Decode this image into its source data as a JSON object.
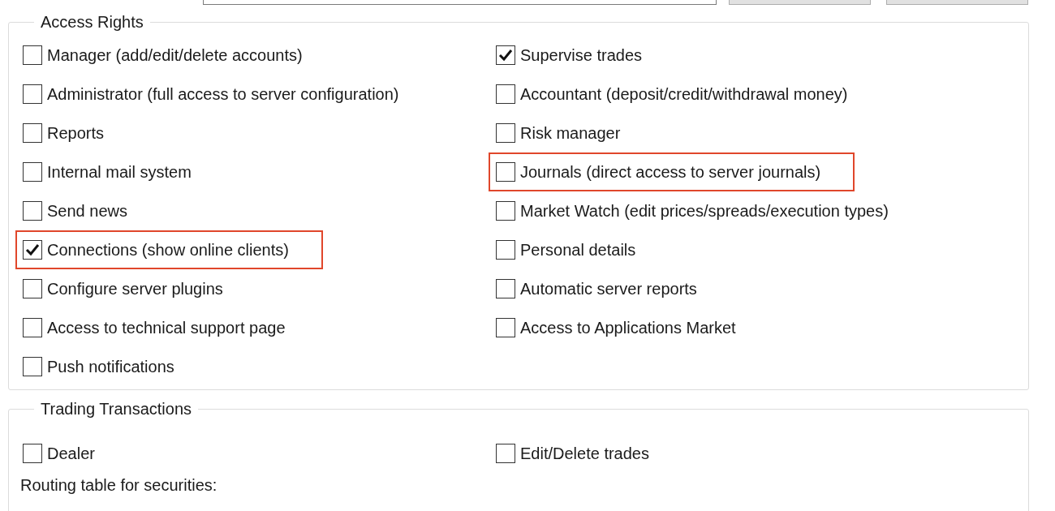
{
  "access_rights": {
    "title": "Access Rights",
    "left_column": [
      {
        "label": "Manager (add/edit/delete accounts)",
        "checked": false,
        "highlighted": false
      },
      {
        "label": "Administrator (full access to server configuration)",
        "checked": false,
        "highlighted": false
      },
      {
        "label": "Reports",
        "checked": false,
        "highlighted": false
      },
      {
        "label": "Internal mail system",
        "checked": false,
        "highlighted": false
      },
      {
        "label": "Send news",
        "checked": false,
        "highlighted": false
      },
      {
        "label": "Connections (show online clients)",
        "checked": true,
        "highlighted": true
      },
      {
        "label": "Configure server plugins",
        "checked": false,
        "highlighted": false
      },
      {
        "label": "Access to technical support page",
        "checked": false,
        "highlighted": false
      },
      {
        "label": "Push notifications",
        "checked": false,
        "highlighted": false
      }
    ],
    "right_column": [
      {
        "label": "Supervise trades",
        "checked": true,
        "highlighted": false
      },
      {
        "label": "Accountant (deposit/credit/withdrawal money)",
        "checked": false,
        "highlighted": false
      },
      {
        "label": "Risk manager",
        "checked": false,
        "highlighted": false
      },
      {
        "label": "Journals (direct access to server journals)",
        "checked": false,
        "highlighted": true
      },
      {
        "label": "Market Watch (edit prices/spreads/execution types)",
        "checked": false,
        "highlighted": false
      },
      {
        "label": "Personal details",
        "checked": false,
        "highlighted": false
      },
      {
        "label": "Automatic server reports",
        "checked": false,
        "highlighted": false
      },
      {
        "label": "Access to Applications Market",
        "checked": false,
        "highlighted": false
      }
    ]
  },
  "trading_transactions": {
    "title": "Trading Transactions",
    "left_column": [
      {
        "label": "Dealer",
        "checked": false,
        "highlighted": false
      }
    ],
    "right_column": [
      {
        "label": "Edit/Delete trades",
        "checked": false,
        "highlighted": false
      }
    ],
    "routing_label": "Routing table for securities:"
  }
}
